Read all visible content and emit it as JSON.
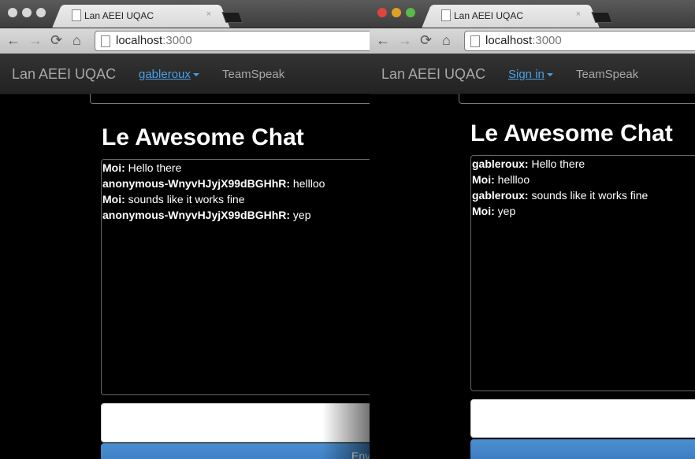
{
  "left": {
    "tab_title": "Lan AEEI UQAC",
    "tab_close": "×",
    "url_host": "localhost",
    "url_port": ":3000",
    "brand": "Lan AEEI UQAC",
    "user_menu": "gableroux",
    "nav_link": "TeamSpeak",
    "chat_title": "Le Awesome Chat",
    "messages": [
      {
        "author": "Moi:",
        "text": " Hello there"
      },
      {
        "author": "anonymous-WnyvHJyjX99dBGHhR:",
        "text": " hellloo"
      },
      {
        "author": "Moi:",
        "text": " sounds like it works fine"
      },
      {
        "author": "anonymous-WnyvHJyjX99dBGHhR:",
        "text": " yep"
      }
    ],
    "send_label": "Env"
  },
  "right": {
    "tab_title": "Lan AEEI UQAC",
    "tab_close": "×",
    "url_host": "localhost",
    "url_port": ":3000",
    "brand": "Lan AEEI UQAC",
    "user_menu": "Sign in",
    "nav_link": "TeamSpeak",
    "chat_title": "Le Awesome Chat",
    "messages": [
      {
        "author": "gableroux:",
        "text": " Hello there"
      },
      {
        "author": "Moi:",
        "text": " hellloo"
      },
      {
        "author": "gableroux:",
        "text": " sounds like it works fine"
      },
      {
        "author": "Moi:",
        "text": " yep"
      }
    ]
  },
  "icons": {
    "back": "←",
    "forward": "→",
    "reload": "⟳",
    "home": "⌂"
  },
  "colors": {
    "link": "#49a0e8",
    "button": "#3b7bbf",
    "traffic_red": "#e0443e",
    "traffic_yellow": "#dea123",
    "traffic_green": "#5cba47",
    "traffic_inactive": "#d8d8d8"
  }
}
